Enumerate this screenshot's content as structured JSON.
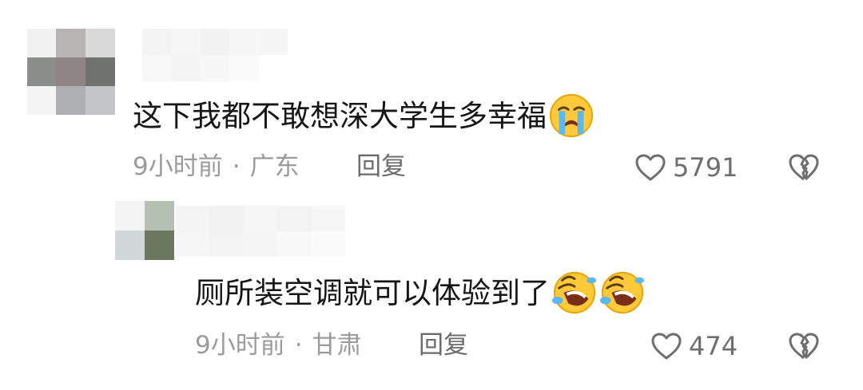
{
  "comments": [
    {
      "text": "这下我都不敢想深大学生多幸福",
      "emoji": "crying-face",
      "time": "9小时前",
      "location": "广东",
      "reply_label": "回复",
      "likes": "5791"
    },
    {
      "text": "厕所装空调就可以体验到了",
      "emoji": "rolling-laughing-face",
      "time": "9小时前",
      "location": "甘肃",
      "reply_label": "回复",
      "likes": "474"
    }
  ],
  "separator": "·",
  "colors": {
    "text": "#161616",
    "meta": "#9b9b9b",
    "reply": "#6b6b6b",
    "icon": "#6e6e6e"
  }
}
